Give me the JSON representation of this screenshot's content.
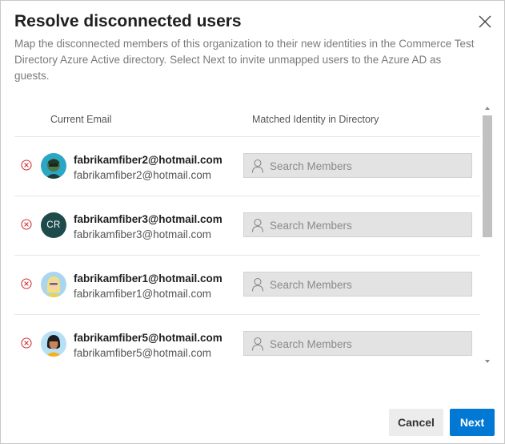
{
  "dialog": {
    "title": "Resolve disconnected users",
    "description": "Map the disconnected members of this organization to their new identities in the Commerce Test Directory Azure Active directory. Select Next to invite unmapped users to the Azure AD as guests.",
    "close_icon": "close-icon"
  },
  "table": {
    "col_email": "Current Email",
    "col_match": "Matched Identity in Directory",
    "rows": [
      {
        "name": "fabrikamfiber2@hotmail.com",
        "email": "fabrikamfiber2@hotmail.com",
        "avatar": "avatar-photo-green",
        "placeholder": "Search Members"
      },
      {
        "name": "fabrikamfiber3@hotmail.com",
        "email": "fabrikamfiber3@hotmail.com",
        "initials": "CR",
        "placeholder": "Search Members"
      },
      {
        "name": "fabrikamfiber1@hotmail.com",
        "email": "fabrikamfiber1@hotmail.com",
        "avatar": "avatar-photo-blonde",
        "placeholder": "Search Members"
      },
      {
        "name": "fabrikamfiber5@hotmail.com",
        "email": "fabrikamfiber5@hotmail.com",
        "avatar": "avatar-photo-dark-hair",
        "placeholder": "Search Members"
      }
    ]
  },
  "footer": {
    "cancel_label": "Cancel",
    "next_label": "Next"
  },
  "colors": {
    "accent": "#0078d4",
    "remove_icon": "#d13438",
    "initials_bg": "#1d4a4a"
  }
}
